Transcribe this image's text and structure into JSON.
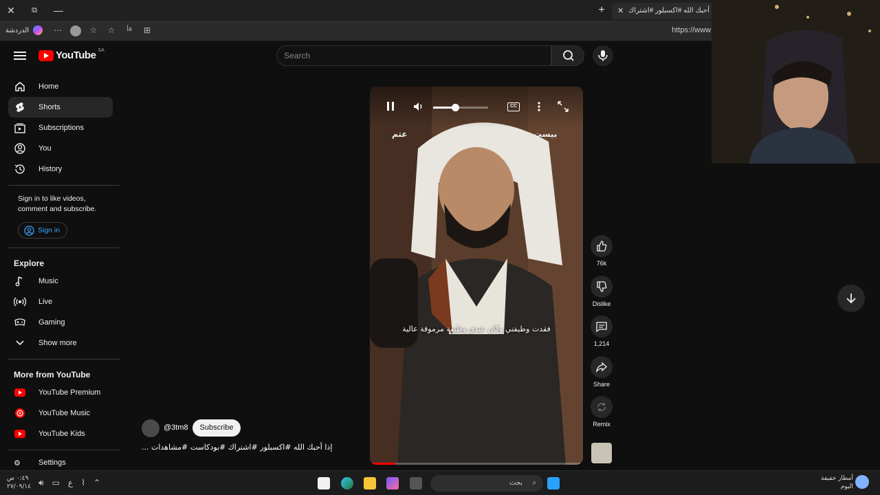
{
  "browser": {
    "tab_title": "إذا أحبك الله #اكسبلور #اشتراك",
    "copilot_label": "الدردشة",
    "url": "https://www",
    "read_aloud_label": "أa"
  },
  "header": {
    "logo_text": "YouTube",
    "region": "SA",
    "search_placeholder": "Search"
  },
  "sidebar": {
    "items": [
      {
        "label": "Home",
        "icon": "home-icon"
      },
      {
        "label": "Shorts",
        "icon": "shorts-icon"
      },
      {
        "label": "Subscriptions",
        "icon": "subscriptions-icon"
      },
      {
        "label": "You",
        "icon": "you-icon"
      },
      {
        "label": "History",
        "icon": "history-icon"
      }
    ],
    "signin_text": "Sign in to like videos, comment and subscribe.",
    "signin_button": "Sign in",
    "explore_title": "Explore",
    "explore": [
      {
        "label": "Music",
        "icon": "music-icon"
      },
      {
        "label": "Live",
        "icon": "live-icon"
      },
      {
        "label": "Gaming",
        "icon": "gaming-icon"
      },
      {
        "label": "Show more",
        "icon": "chevron-down-icon"
      }
    ],
    "more_title": "More from YouTube",
    "more": [
      {
        "label": "YouTube Premium",
        "icon": "youtube-premium-icon"
      },
      {
        "label": "YouTube Music",
        "icon": "youtube-music-icon"
      },
      {
        "label": "YouTube Kids",
        "icon": "youtube-kids-icon"
      }
    ],
    "settings": "Settings"
  },
  "player": {
    "caption": "فقدت وظيفتي وكان عندي وظيفة مرموقة عالية",
    "watermark_left": "عتم",
    "watermark_right": "بيست",
    "cc_label": "CC",
    "volume_fraction": 0.4,
    "progress_fraction": 0.12
  },
  "actions": {
    "like_count": "76k",
    "dislike_label": "Dislike",
    "comment_count": "1,214",
    "share_label": "Share",
    "remix_label": "Remix"
  },
  "channel": {
    "handle": "@3tm8",
    "subscribe_label": "Subscribe",
    "video_title": "إذا أحبك الله #اكسبلور #اشتراك #بودكاست #مشاهدات ..."
  },
  "taskbar": {
    "time": "٠:٤٩ ص",
    "date": "٢٧/٠٩/١٤",
    "search_placeholder": "بحث",
    "lang": "ع",
    "weather_line1": "أمطار خفيفة",
    "weather_line2": "اليوم"
  },
  "colors": {
    "background": "#0f0f0f",
    "accent_red": "#ff0000",
    "link_blue": "#3ea6ff"
  }
}
